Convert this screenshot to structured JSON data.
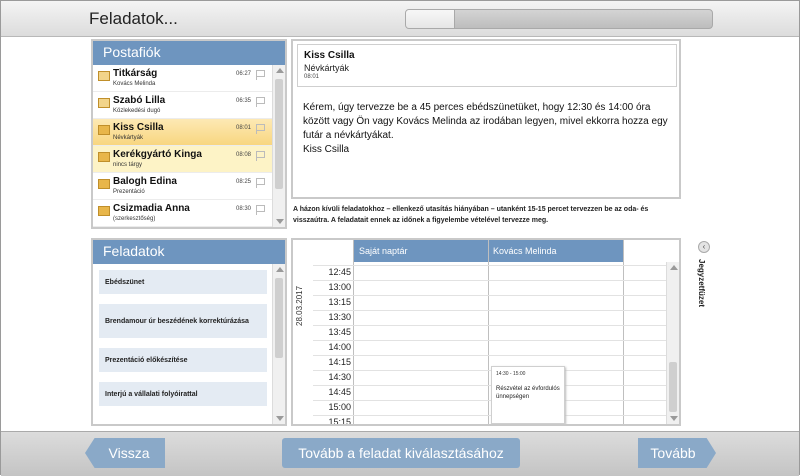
{
  "header": {
    "title": "Feladatok...",
    "progress": 0.16
  },
  "mailbox": {
    "title": "Postafiók",
    "items": [
      {
        "sender": "Titkárság",
        "subject": "Kovács Melinda",
        "time": "06:27",
        "state": "open"
      },
      {
        "sender": "Szabó Lilla",
        "subject": "Közlekedési dugó",
        "time": "06:35",
        "state": "open"
      },
      {
        "sender": "Kiss Csilla",
        "subject": "Névkártyák",
        "time": "08:01",
        "state": "selected"
      },
      {
        "sender": "Kerékgyártó Kinga",
        "subject": "nincs tárgy",
        "time": "08:08",
        "state": "highlight"
      },
      {
        "sender": "Balogh Edina",
        "subject": "Prezentáció",
        "time": "08:25",
        "state": "unread"
      },
      {
        "sender": "Csizmadia Anna",
        "subject": "(szerkesztőség)",
        "time": "08:30",
        "state": "unread"
      }
    ]
  },
  "message": {
    "sender": "Kiss Csilla",
    "subject": "Névkártyák",
    "time": "08:01",
    "body": "Kérem, úgy tervezze be a 45 perces ebédszünetüket, hogy  12:30 és 14:00 óra között vagy Ön vagy Kovács Melinda az irodában legyen, mivel ekkorra hozza egy futár a névkártyákat.",
    "signature": "Kiss Csilla"
  },
  "instruction": "A házon kívüli feladatokhoz – ellenkező utasítás hiányában – utanként 15-15 percet tervezzen be az oda- és visszaútra. A feladatait ennek az időnek a figyelembe vételével tervezze meg.",
  "tasks": {
    "title": "Feladatok",
    "items": [
      "Ebédszünet",
      "Brendamour úr beszédének korrektúrázása",
      "Prezentáció előkészítése",
      "Interjú a vállalati folyóirattal"
    ]
  },
  "calendar": {
    "date": "28.03.2017",
    "columns": [
      "Saját naptár",
      "Kovács Melinda"
    ],
    "times": [
      "12:45",
      "13:00",
      "13:15",
      "13:30",
      "13:45",
      "14:00",
      "14:15",
      "14:30",
      "14:45",
      "15:00",
      "15:15"
    ],
    "event": {
      "time": "14:30 - 15:00",
      "title": "Részvétel az évfordulós ünnepségen"
    }
  },
  "side_panel": {
    "label": "Jegyzetfüzet",
    "toggle_icon": "‹"
  },
  "footer": {
    "back_label": "Vissza",
    "task_label": "Tovább a feladat kiválasztásához",
    "next_label": "Tovább"
  }
}
